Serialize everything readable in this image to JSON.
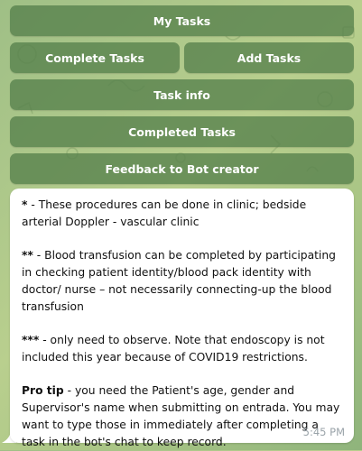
{
  "keyboard": {
    "my_tasks": "My Tasks",
    "complete_tasks": "Complete Tasks",
    "add_tasks": "Add Tasks",
    "task_info": "Task info",
    "completed_tasks": "Completed Tasks",
    "feedback": "Feedback to Bot creator"
  },
  "message": {
    "p1_mark": "*",
    "p1_text": " - These procedures can be done in clinic; bedside arterial Doppler - vascular clinic",
    "p2_mark": "**",
    "p2_text": " - Blood transfusion can be completed by participating in checking patient identity/blood pack identity with doctor/ nurse – not necessarily connecting-up the blood transfusion",
    "p3_mark": "***",
    "p3_text": " - only need to observe. Note that endoscopy is not included this year because of COVID19 restrictions.",
    "tip_label": "Pro tip",
    "tip_text": " - you need the Patient's age, gender and Supervisor's name when submitting on entrada. You may want to type those in immediately after completing a task in the bot's chat to keep record.",
    "time": "5:45 PM"
  },
  "colors": {
    "button_bg": "#56804c",
    "chat_bg": "#b9cf8e",
    "bubble_bg": "#ffffff"
  }
}
